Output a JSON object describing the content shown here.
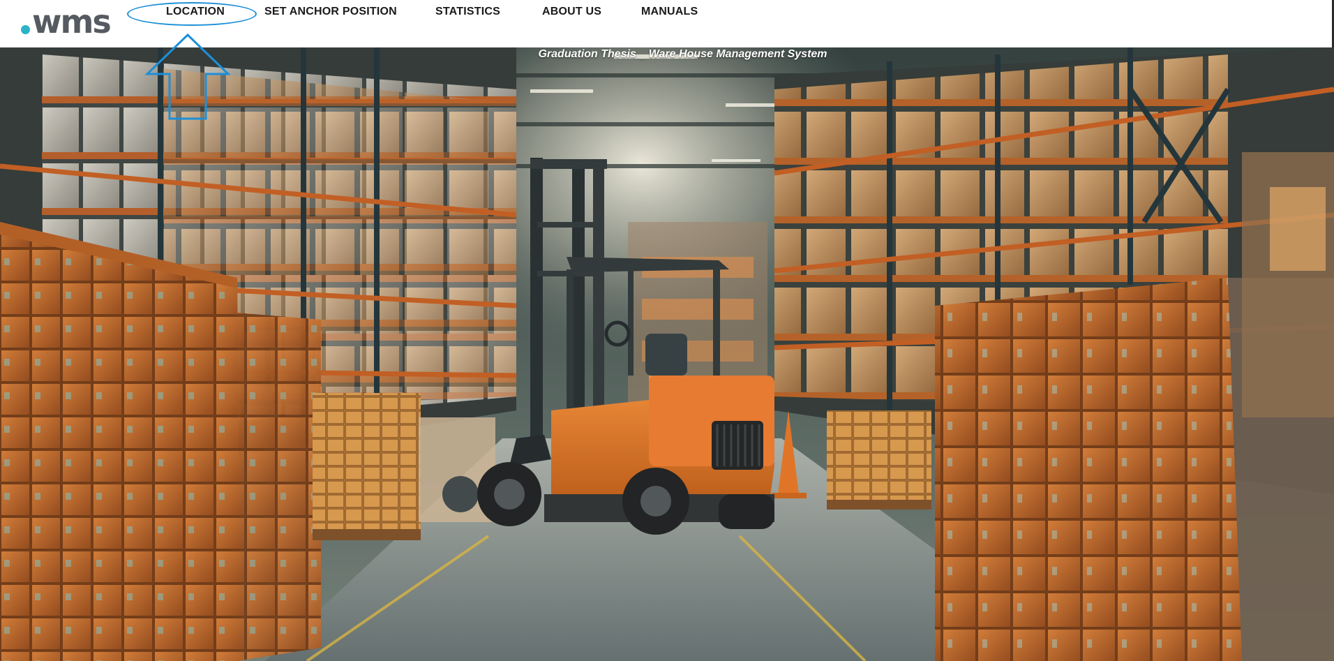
{
  "brand": {
    "logo_text": "wms",
    "accent_color": "#2bb3c8"
  },
  "nav": {
    "items": [
      {
        "label": "LOCATION",
        "highlighted": true
      },
      {
        "label": "SET ANCHOR POSITION"
      },
      {
        "label": "STATISTICS"
      },
      {
        "label": "ABOUT US"
      },
      {
        "label": "MANUALS"
      }
    ],
    "annotation_color": "#1d8fd8"
  },
  "hero": {
    "caption": "Graduation Thesis _ Ware House Management System",
    "image_subject": "warehouse aisle with orange forklift and stacked boxes"
  }
}
